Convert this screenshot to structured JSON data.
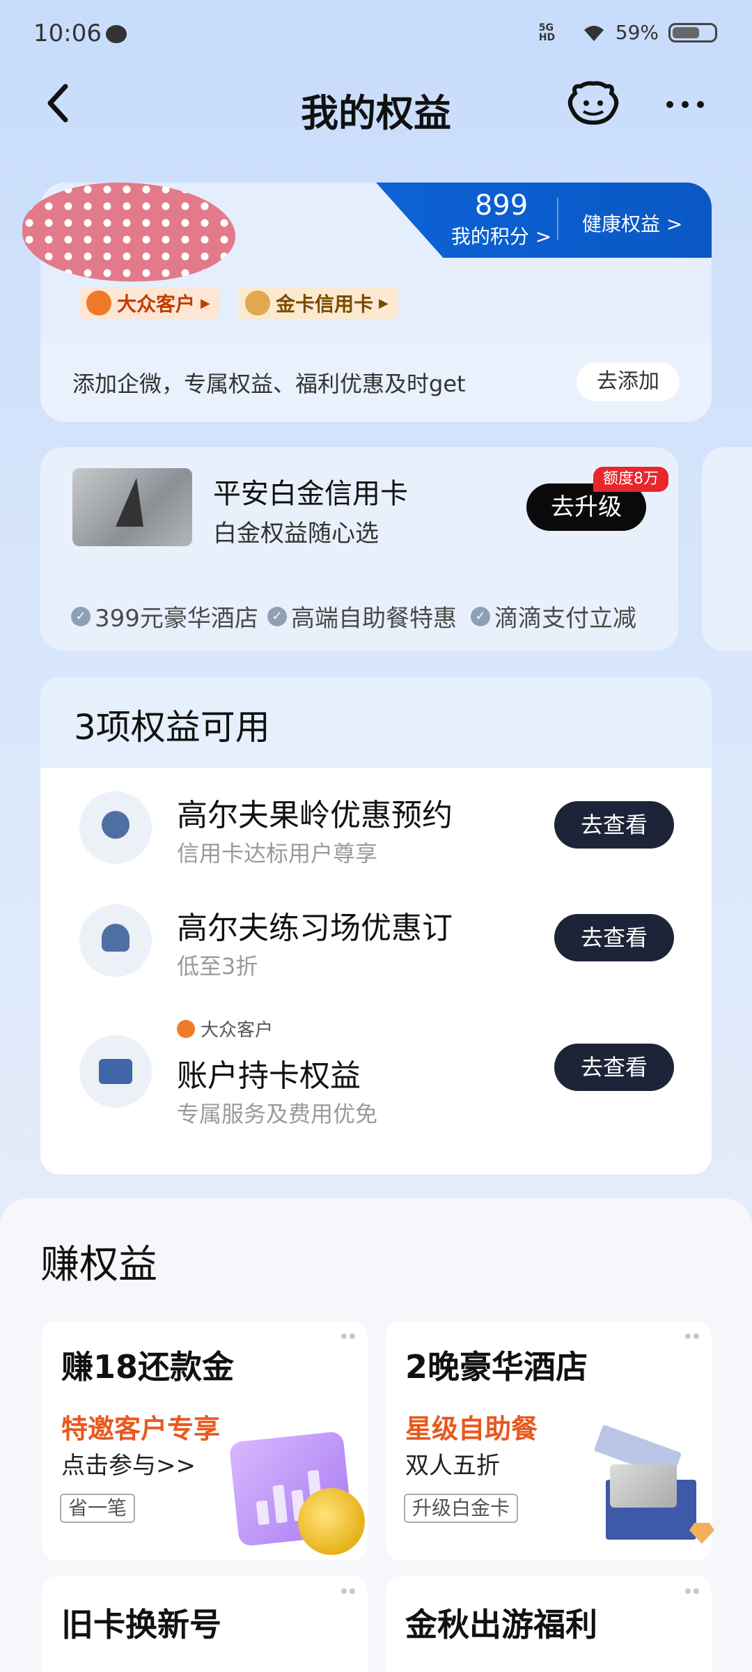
{
  "status_bar": {
    "time": "10:06",
    "network": "5G HD",
    "battery": "59%",
    "battery_level": 0.59
  },
  "header": {
    "title": "我的权益"
  },
  "member": {
    "points": "899",
    "points_label": "我的积分 >",
    "health_label": "健康权益 >",
    "tags": [
      "大众客户",
      "金卡信用卡"
    ],
    "wecom_text": "添加企微，专属权益、福利优惠及时get",
    "wecom_button": "去添加"
  },
  "promo": {
    "title": "平安白金信用卡",
    "subtitle": "白金权益随心选",
    "button": "去升级",
    "badge": "额度8万",
    "perks": [
      "399元豪华酒店",
      "高端自助餐特惠",
      "滴滴支付立减"
    ]
  },
  "benefits": {
    "title": "3项权益可用",
    "items": [
      {
        "title": "高尔夫果岭优惠预约",
        "subtitle": "信用卡达标用户尊享",
        "button": "去查看",
        "icon": "golf-ball-icon"
      },
      {
        "title": "高尔夫练习场优惠订",
        "subtitle": "低至3折",
        "button": "去查看",
        "icon": "user-icon"
      },
      {
        "tag": "大众客户",
        "title": "账户持卡权益",
        "subtitle": "专属服务及费用优免",
        "button": "去查看",
        "icon": "card-icon"
      }
    ]
  },
  "earn": {
    "title": "赚权益",
    "tiles": [
      {
        "title": "赚18还款金",
        "highlight": "特邀客户专享",
        "body": "点击参与>>",
        "tag": "省一笔"
      },
      {
        "title": "2晚豪华酒店",
        "highlight": "星级自助餐",
        "body": "双人五折",
        "tag": "升级白金卡"
      },
      {
        "title": "旧卡换新号"
      },
      {
        "title": "金秋出游福利"
      }
    ]
  }
}
